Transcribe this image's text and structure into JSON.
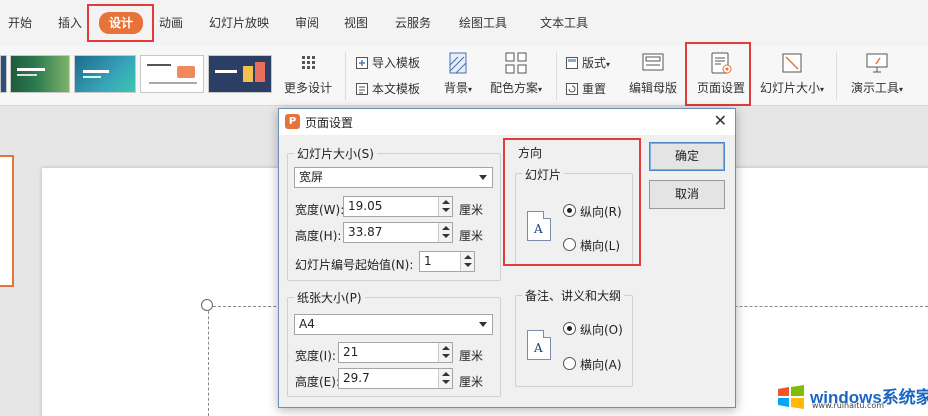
{
  "tabs": [
    "开始",
    "插入",
    "设计",
    "动画",
    "幻灯片放映",
    "审阅",
    "视图",
    "云服务",
    "绘图工具",
    "文本工具"
  ],
  "active_tab": "设计",
  "accent_color": "#e8733a",
  "highlight_color": "#e03c3c",
  "toolbar": {
    "more_designs": "更多设计",
    "import_template": "导入模板",
    "text_template": "本文模板",
    "background": "背景",
    "color_scheme": "配色方案",
    "layout": "版式",
    "reset": "重置",
    "edit_master": "编辑母版",
    "page_setup": "页面设置",
    "slide_size": "幻灯片大小",
    "presenter_tools": "演示工具"
  },
  "dialog": {
    "title": "页面设置",
    "slide_size_group": "幻灯片大小(S)",
    "slide_size_value": "宽屏",
    "width_label": "宽度(W):",
    "width_value": "19.05",
    "height_label": "高度(H):",
    "height_value": "33.87",
    "unit": "厘米",
    "start_number_label": "幻灯片编号起始值(N):",
    "start_number_value": "1",
    "paper_size_group": "纸张大小(P)",
    "paper_size_value": "A4",
    "paper_width_label": "宽度(I):",
    "paper_width_value": "21",
    "paper_height_label": "高度(E):",
    "paper_height_value": "29.7",
    "orientation_group": "方向",
    "slides_subgroup": "幻灯片",
    "portrait": "纵向(R)",
    "landscape": "横向(L)",
    "notes_subgroup": "备注、讲义和大纲",
    "notes_portrait": "纵向(O)",
    "notes_landscape": "横向(A)",
    "slides_orientation": "portrait",
    "notes_orientation": "portrait",
    "doc_icon_letter": "A",
    "ok": "确定",
    "cancel": "取消"
  },
  "watermark": {
    "text": "windows系统家园",
    "url": "www.ruihaitu.com"
  }
}
